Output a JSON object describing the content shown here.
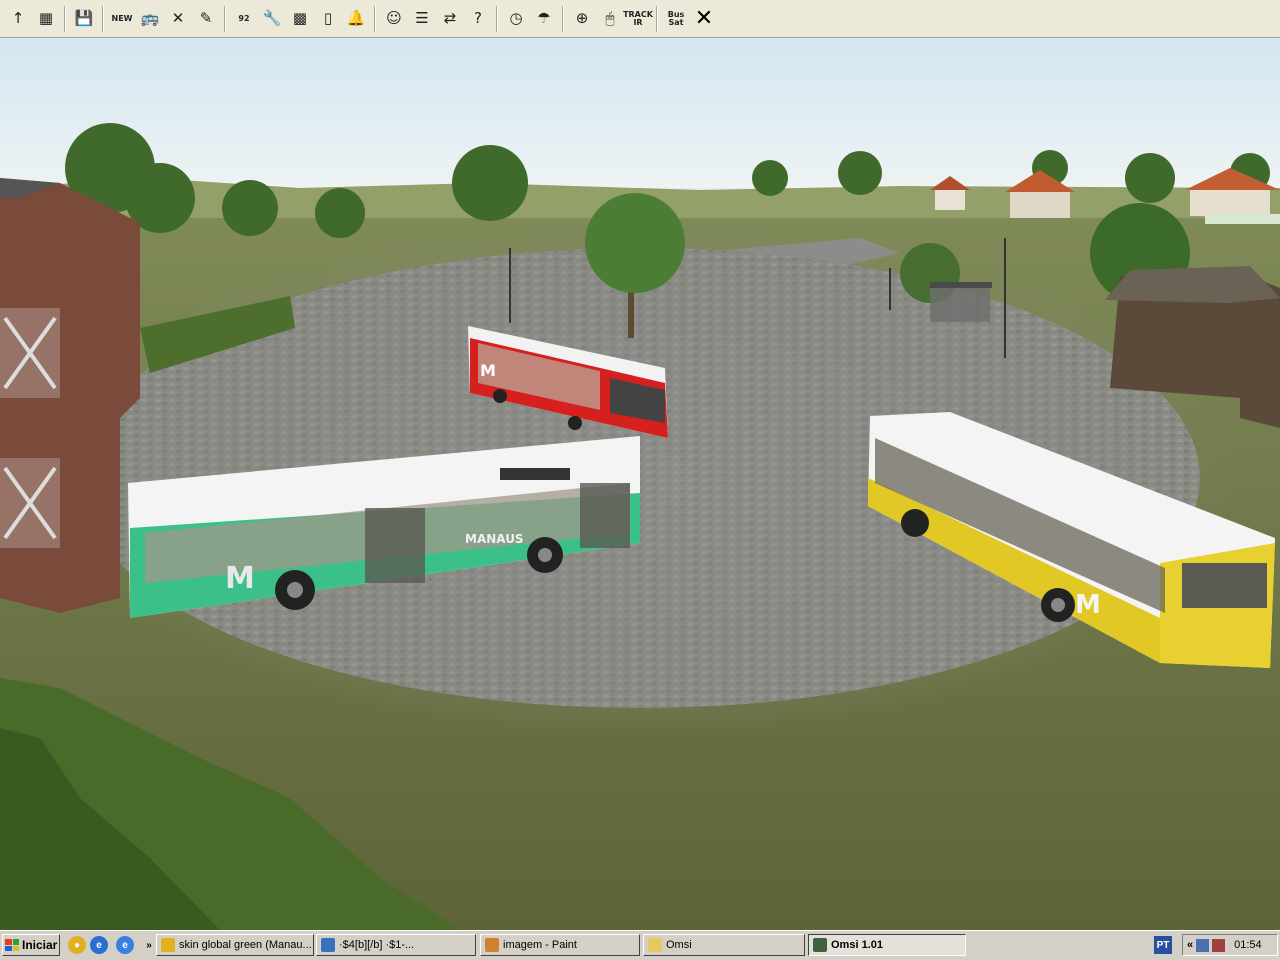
{
  "toolbar": {
    "buttons": [
      {
        "name": "up-arrow-icon",
        "glyph": "↑"
      },
      {
        "name": "map-icon",
        "glyph": "▦"
      },
      {
        "sep": true
      },
      {
        "name": "save-icon",
        "glyph": "💾"
      },
      {
        "sep": true
      },
      {
        "name": "new-bus-icon",
        "text": "NEW"
      },
      {
        "name": "bus-icon",
        "glyph": "🚌"
      },
      {
        "name": "delete-bus-icon",
        "glyph": "✕"
      },
      {
        "name": "pen-icon",
        "glyph": "✎"
      },
      {
        "sep": true
      },
      {
        "name": "schedule-icon",
        "text": "92"
      },
      {
        "name": "wrench-icon",
        "glyph": "🔧"
      },
      {
        "name": "seat-icon",
        "glyph": "▩"
      },
      {
        "name": "door-icon",
        "glyph": "▯"
      },
      {
        "name": "bell-icon",
        "glyph": "🔔"
      },
      {
        "sep": true
      },
      {
        "name": "driver-icon",
        "glyph": "☺"
      },
      {
        "name": "timetable-icon",
        "glyph": "☰"
      },
      {
        "name": "route-icon",
        "glyph": "⇄"
      },
      {
        "name": "help-icon",
        "glyph": "?"
      },
      {
        "sep": true
      },
      {
        "name": "clock-icon",
        "glyph": "◷"
      },
      {
        "name": "weather-icon",
        "glyph": "☂"
      },
      {
        "sep": true
      },
      {
        "name": "compass-icon",
        "glyph": "⊕"
      },
      {
        "name": "mouse-icon",
        "glyph": "🖱"
      },
      {
        "name": "track-ir-icon",
        "text": "TRACK IR"
      },
      {
        "sep": true
      },
      {
        "name": "options-icon",
        "text": "Bus Sat"
      },
      {
        "name": "close-icon",
        "glyph": "✕",
        "close": true
      }
    ]
  },
  "taskbar": {
    "start_label": "Iniciar",
    "quicklaunch": [
      {
        "name": "chrome-icon",
        "glyph": "●",
        "color": "#e0b020"
      },
      {
        "name": "ie-icon",
        "glyph": "e",
        "color": "#2a6fd0"
      },
      {
        "name": "ie-icon-2",
        "glyph": "e",
        "color": "#3a80e0"
      }
    ],
    "overflow": "»",
    "tasks": [
      {
        "label": "skin global green (Manau...",
        "color": "#e0b020"
      },
      {
        "label": "·$4[b][/b]              ·$1-...",
        "color": "#3a70c0"
      },
      {
        "label": "imagem - Paint",
        "color": "#d08030"
      },
      {
        "label": "Omsi",
        "color": "#e8c860"
      },
      {
        "label": "Omsi 1.01",
        "color": "#406040",
        "active": true
      }
    ],
    "lang": "PT",
    "tray_chevron": "«",
    "clock": "01:54"
  }
}
